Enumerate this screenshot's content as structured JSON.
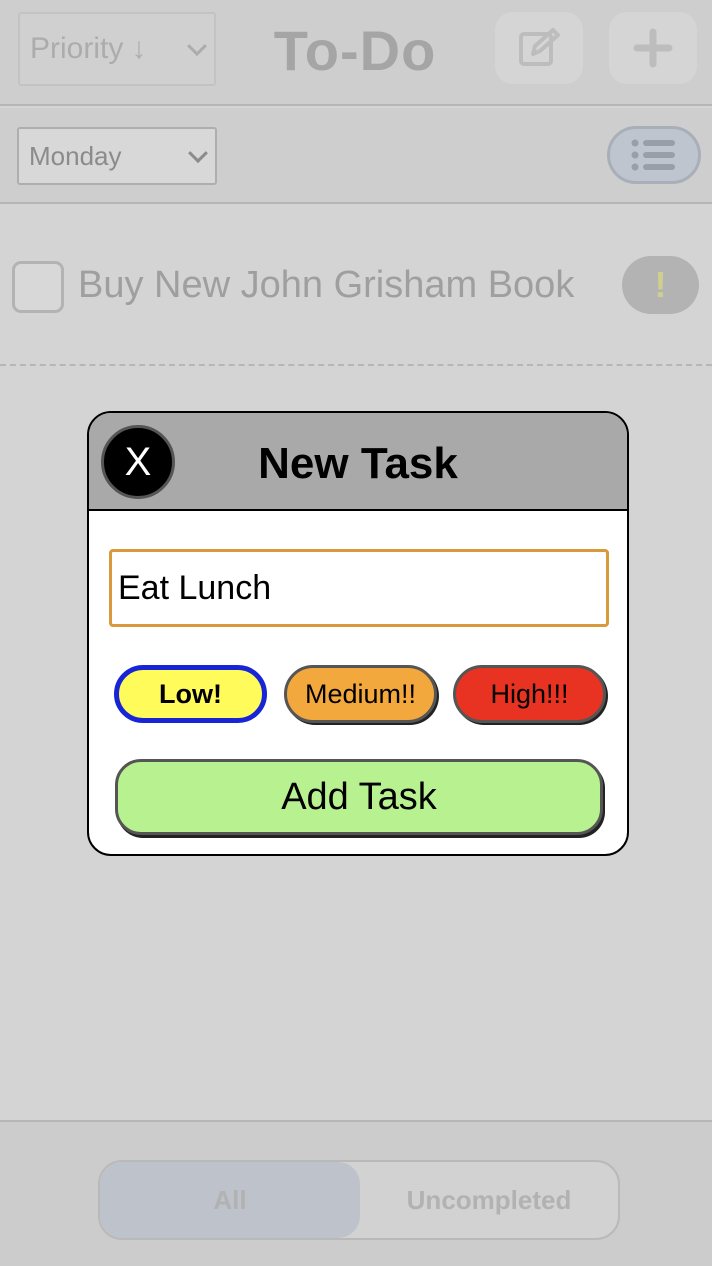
{
  "app": {
    "title": "To-Do",
    "sort_select": {
      "value": "Priority",
      "arrow": "↓"
    },
    "day_select": {
      "value": "Monday"
    },
    "icons": {
      "edit": "edit-icon",
      "add": "plus-icon",
      "list": "list-icon",
      "sort_arrow": "arrow-down-icon"
    }
  },
  "tasks": [
    {
      "text": "Buy New John Grisham Book",
      "priority_marker": "!",
      "completed": false
    }
  ],
  "filter_tabs": [
    {
      "label": "All",
      "selected": true
    },
    {
      "label": "Uncompleted",
      "selected": false
    }
  ],
  "modal": {
    "title": "New Task",
    "close_label": "X",
    "input_value": "Eat Lunch",
    "priorities": [
      {
        "label": "Low!",
        "color": "#fffb5a",
        "selected": true
      },
      {
        "label": "Medium!!",
        "color": "#f3a83e",
        "selected": false
      },
      {
        "label": "High!!!",
        "color": "#e83222",
        "selected": false
      }
    ],
    "submit_label": "Add Task"
  },
  "colors": {
    "selected_outline": "#1725d6",
    "input_border": "#d99a3b",
    "add_button": "#b8f290",
    "header_gray": "#a9a9a9"
  }
}
